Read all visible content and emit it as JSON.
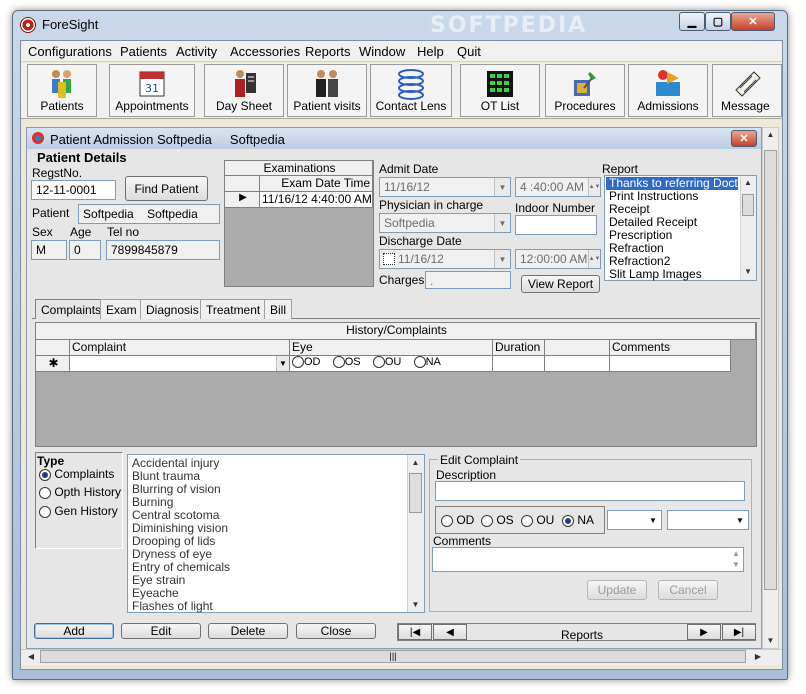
{
  "window": {
    "title": "ForeSight",
    "watermark": "SOFTPEDIA"
  },
  "menu": [
    "Configurations",
    "Patients",
    "Activity",
    "Accessories",
    "Reports",
    "Window",
    "Help",
    "Quit"
  ],
  "toolbar": [
    {
      "label": "Patients",
      "icon": "patients-icon"
    },
    {
      "label": "Appointments",
      "icon": "calendar-icon"
    },
    {
      "label": "Day Sheet",
      "icon": "day-sheet-icon"
    },
    {
      "label": "Patient visits",
      "icon": "patient-visits-icon"
    },
    {
      "label": "Contact Lens",
      "icon": "contact-lens-icon"
    },
    {
      "label": "OT List",
      "icon": "ot-list-icon"
    },
    {
      "label": "Procedures",
      "icon": "procedures-icon"
    },
    {
      "label": "Admissions",
      "icon": "admissions-icon"
    },
    {
      "label": "Message",
      "icon": "message-icon"
    }
  ],
  "child": {
    "title": "Patient Admission Softpedia     Softpedia",
    "close": "✕"
  },
  "patient": {
    "heading": "Patient Details",
    "regst_label": "RegstNo.",
    "regst_value": "12-11-0001",
    "find_button": "Find Patient",
    "patient_label": "Patient",
    "first_name": "Softpedia",
    "last_name": "Softpedia",
    "sex_label": "Sex",
    "age_label": "Age",
    "tel_label": "Tel no",
    "sex_value": "M",
    "age_value": "0",
    "tel_value": "7899845879"
  },
  "examinations": {
    "title": "Examinations",
    "column": "Exam Date Time",
    "rows": [
      "11/16/12 4:40:00 AM"
    ]
  },
  "admission": {
    "admit_label": "Admit Date",
    "admit_date": "11/16/12",
    "admit_time": "4 :40:00 AM",
    "physician_label": "Physician in charge",
    "physician_value": "Softpedia",
    "indoor_label": "Indoor Number",
    "indoor_value": "",
    "discharge_label": "Discharge Date",
    "discharge_date": "11/16/12",
    "discharge_time": "12:00:00 AM",
    "charges_label": "Charges",
    "charges_value": ".",
    "view_report": "View Report"
  },
  "report": {
    "label": "Report",
    "items": [
      "Thanks to referring Doctor",
      "Print Instructions",
      "Receipt",
      "Detailed Receipt",
      "Prescription",
      "Refraction",
      "Refraction2",
      "Slit Lamp Images"
    ],
    "selected_index": 0
  },
  "tabs": [
    "Complaints",
    "Exam",
    "Diagnosis",
    "Treatment",
    "Bill"
  ],
  "history": {
    "title": "History/Complaints",
    "columns": [
      "Complaint",
      "Eye",
      "Duration",
      "Comments"
    ],
    "new_row_marker": "✱",
    "eye_options": [
      "OD",
      "OS",
      "OU",
      "NA"
    ]
  },
  "type": {
    "label": "Type",
    "options": [
      "Complaints",
      "Opth History",
      "Gen History"
    ],
    "selected_index": 0
  },
  "complaint_list": [
    "Accidental injury",
    "Blunt  trauma",
    "Blurring of vision",
    "Burning",
    "Central scotoma",
    "Diminishing vision",
    "Drooping of lids",
    "Dryness  of  eye",
    "Entry  of  chemicals",
    "Eye  strain",
    "Eyeache",
    "Flashes of light"
  ],
  "edit": {
    "title": "Edit Complaint",
    "description_label": "Description",
    "description_value": "",
    "eye_options": [
      "OD",
      "OS",
      "OU",
      "NA"
    ],
    "eye_selected_index": 3,
    "comments_label": "Comments",
    "update": "Update",
    "cancel": "Cancel"
  },
  "actions": [
    "Add",
    "Edit",
    "Delete",
    "Close"
  ],
  "nav": {
    "label": "Reports"
  },
  "bottom_scroll_grip": "|||",
  "colors": {
    "selection": "#3169c6",
    "accent": "#0a246a"
  }
}
